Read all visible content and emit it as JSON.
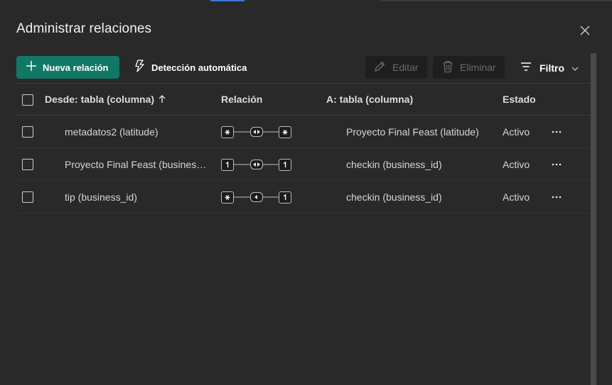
{
  "dialog": {
    "title": "Administrar relaciones"
  },
  "toolbar": {
    "new_label": "Nueva relación",
    "auto_label": "Detección automática",
    "edit_label": "Editar",
    "delete_label": "Eliminar",
    "filter_label": "Filtro"
  },
  "table": {
    "headers": {
      "from": "Desde: tabla (columna)",
      "relation": "Relación",
      "to": "A: tabla (columna)",
      "status": "Estado"
    },
    "rows": [
      {
        "from": "metadatos2 (latitude)",
        "left": "*",
        "filter": "both",
        "right": "*",
        "to": "Proyecto Final Feast (latitude)",
        "status": "Activo"
      },
      {
        "from": "Proyecto Final Feast (business_id)",
        "left": "1",
        "filter": "both",
        "right": "1",
        "to": "checkin (business_id)",
        "status": "Activo"
      },
      {
        "from": "tip (business_id)",
        "left": "*",
        "filter": "single",
        "right": "1",
        "to": "checkin (business_id)",
        "status": "Activo"
      }
    ]
  },
  "icons": {
    "close": "close-icon",
    "add": "plus-icon",
    "auto": "lightning-icon",
    "edit": "pencil-icon",
    "delete": "trash-icon",
    "filter": "filter-lines-icon",
    "chevron": "chevron-down-icon",
    "sort": "arrow-up-icon",
    "more": "more-horizontal-icon"
  },
  "colors": {
    "primary": "#117865",
    "background": "#292929"
  }
}
